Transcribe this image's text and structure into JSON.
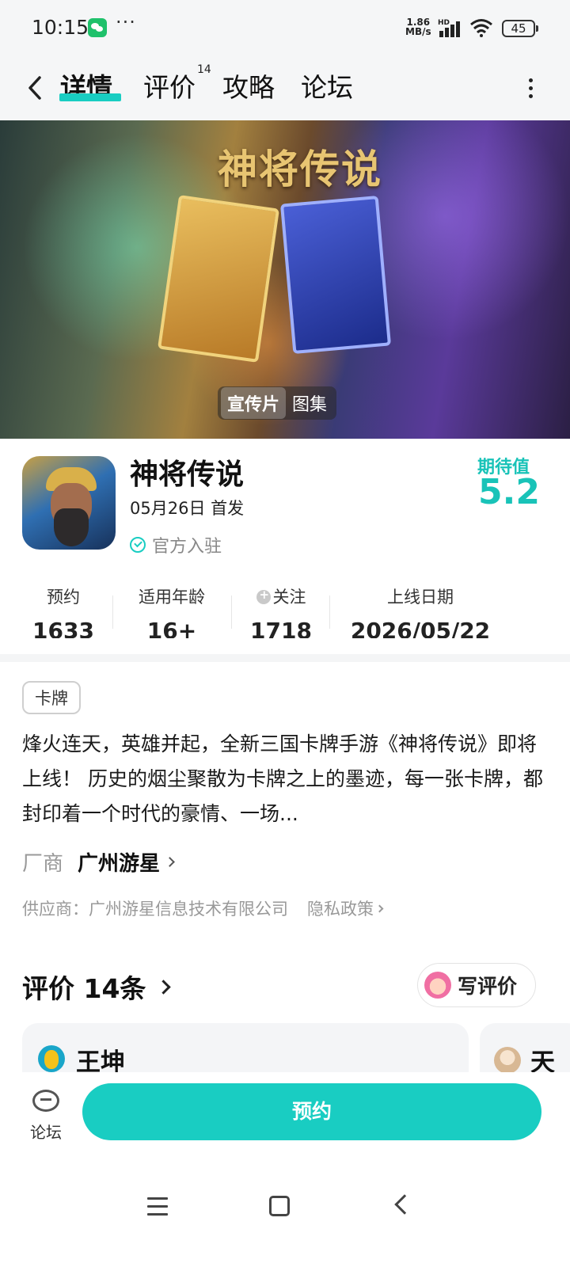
{
  "status_bar": {
    "time": "10:15",
    "dots": "···",
    "speed_value": "1.86",
    "speed_unit": "MB/s",
    "hd": "HD",
    "battery": "45"
  },
  "nav": {
    "tabs": [
      {
        "label": "详情",
        "active": true
      },
      {
        "label": "评价",
        "badge": "14"
      },
      {
        "label": "攻略"
      },
      {
        "label": "论坛"
      }
    ]
  },
  "banner": {
    "logo_text": "神将传说",
    "media_tabs": [
      {
        "label": "宣传片",
        "active": true
      },
      {
        "label": "图集"
      }
    ]
  },
  "game": {
    "name": "神将传说",
    "release_note": "05月26日 首发",
    "official_label": "官方入驻",
    "expect_label": "期待值",
    "expect_score": "5.2"
  },
  "stats": [
    {
      "label": "预约",
      "value": "1633"
    },
    {
      "label": "适用年龄",
      "value": "16+"
    },
    {
      "label": "关注",
      "value": "1718"
    },
    {
      "label": "上线日期",
      "value": "2026/05/22"
    }
  ],
  "details": {
    "genre_tag": "卡牌",
    "description": "烽火连天，英雄并起，全新三国卡牌手游《神将传说》即将上线！ 历史的烟尘聚散为卡牌之上的墨迹，每一张卡牌，都封印着一个时代的豪情、一场...",
    "vendor_label": "厂商",
    "vendor_name": "广州游星",
    "supplier": "供应商：广州游星信息技术有限公司",
    "privacy": "隐私政策"
  },
  "reviews": {
    "title": "评价 14条",
    "write_button": "写评价",
    "cards": [
      {
        "user": "王坤"
      },
      {
        "user": "天"
      }
    ]
  },
  "action_bar": {
    "forum_label": "论坛",
    "reserve_label": "预约"
  },
  "colors": {
    "accent": "#19cdc2",
    "score": "#19c3b8",
    "page_bg": "#ffffff",
    "header_bg": "#f5f6f7"
  },
  "icons": [
    "back-arrow-icon",
    "more-vertical-icon",
    "wechat-icon",
    "signal-icon",
    "wifi-icon",
    "battery-icon",
    "verified-check-icon",
    "follow-heart-icon",
    "chevron-right-icon",
    "forum-chat-icon",
    "menu-icon",
    "home-icon",
    "nav-back-icon"
  ]
}
